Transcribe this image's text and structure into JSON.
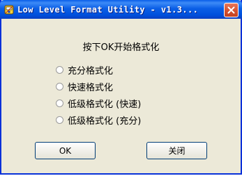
{
  "window": {
    "title": "Low Level Format Utility - v1.3...",
    "icon": "format-utility-icon",
    "close_icon": "close-icon"
  },
  "dialog": {
    "heading": "按下OK开始格式化",
    "options": [
      {
        "label": "充分格式化",
        "selected": false
      },
      {
        "label": "快速格式化",
        "selected": false
      },
      {
        "label": "低级格式化 (快速)",
        "selected": false
      },
      {
        "label": "低级格式化 (充分)",
        "selected": false
      }
    ],
    "ok_label": "OK",
    "close_label": "关闭"
  },
  "colors": {
    "title_bar": "#0054e3",
    "window_bg": "#ece9d8",
    "close_button": "#d4512f"
  }
}
